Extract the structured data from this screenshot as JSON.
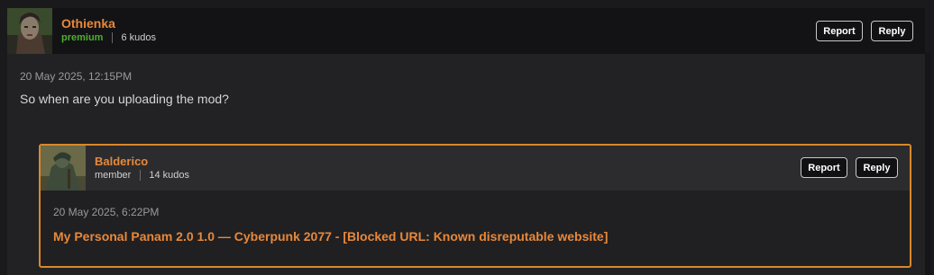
{
  "comment": {
    "author": "Othienka",
    "rank": "premium",
    "kudos": "6 kudos",
    "report_label": "Report",
    "reply_label": "Reply",
    "date": "20 May 2025, 12:15PM",
    "text": "So when are you uploading the mod?"
  },
  "reply": {
    "author": "Balderico",
    "rank": "member",
    "kudos": "14 kudos",
    "report_label": "Report",
    "reply_label": "Reply",
    "date": "20 May 2025, 6:22PM",
    "link_text": "My Personal Panam 2.0 1.0 — Cyberpunk 2077 - [Blocked URL: Known disreputable website]"
  },
  "colors": {
    "accent": "#e8883a",
    "premium": "#4caf2e",
    "reply_border": "#d9882c"
  }
}
